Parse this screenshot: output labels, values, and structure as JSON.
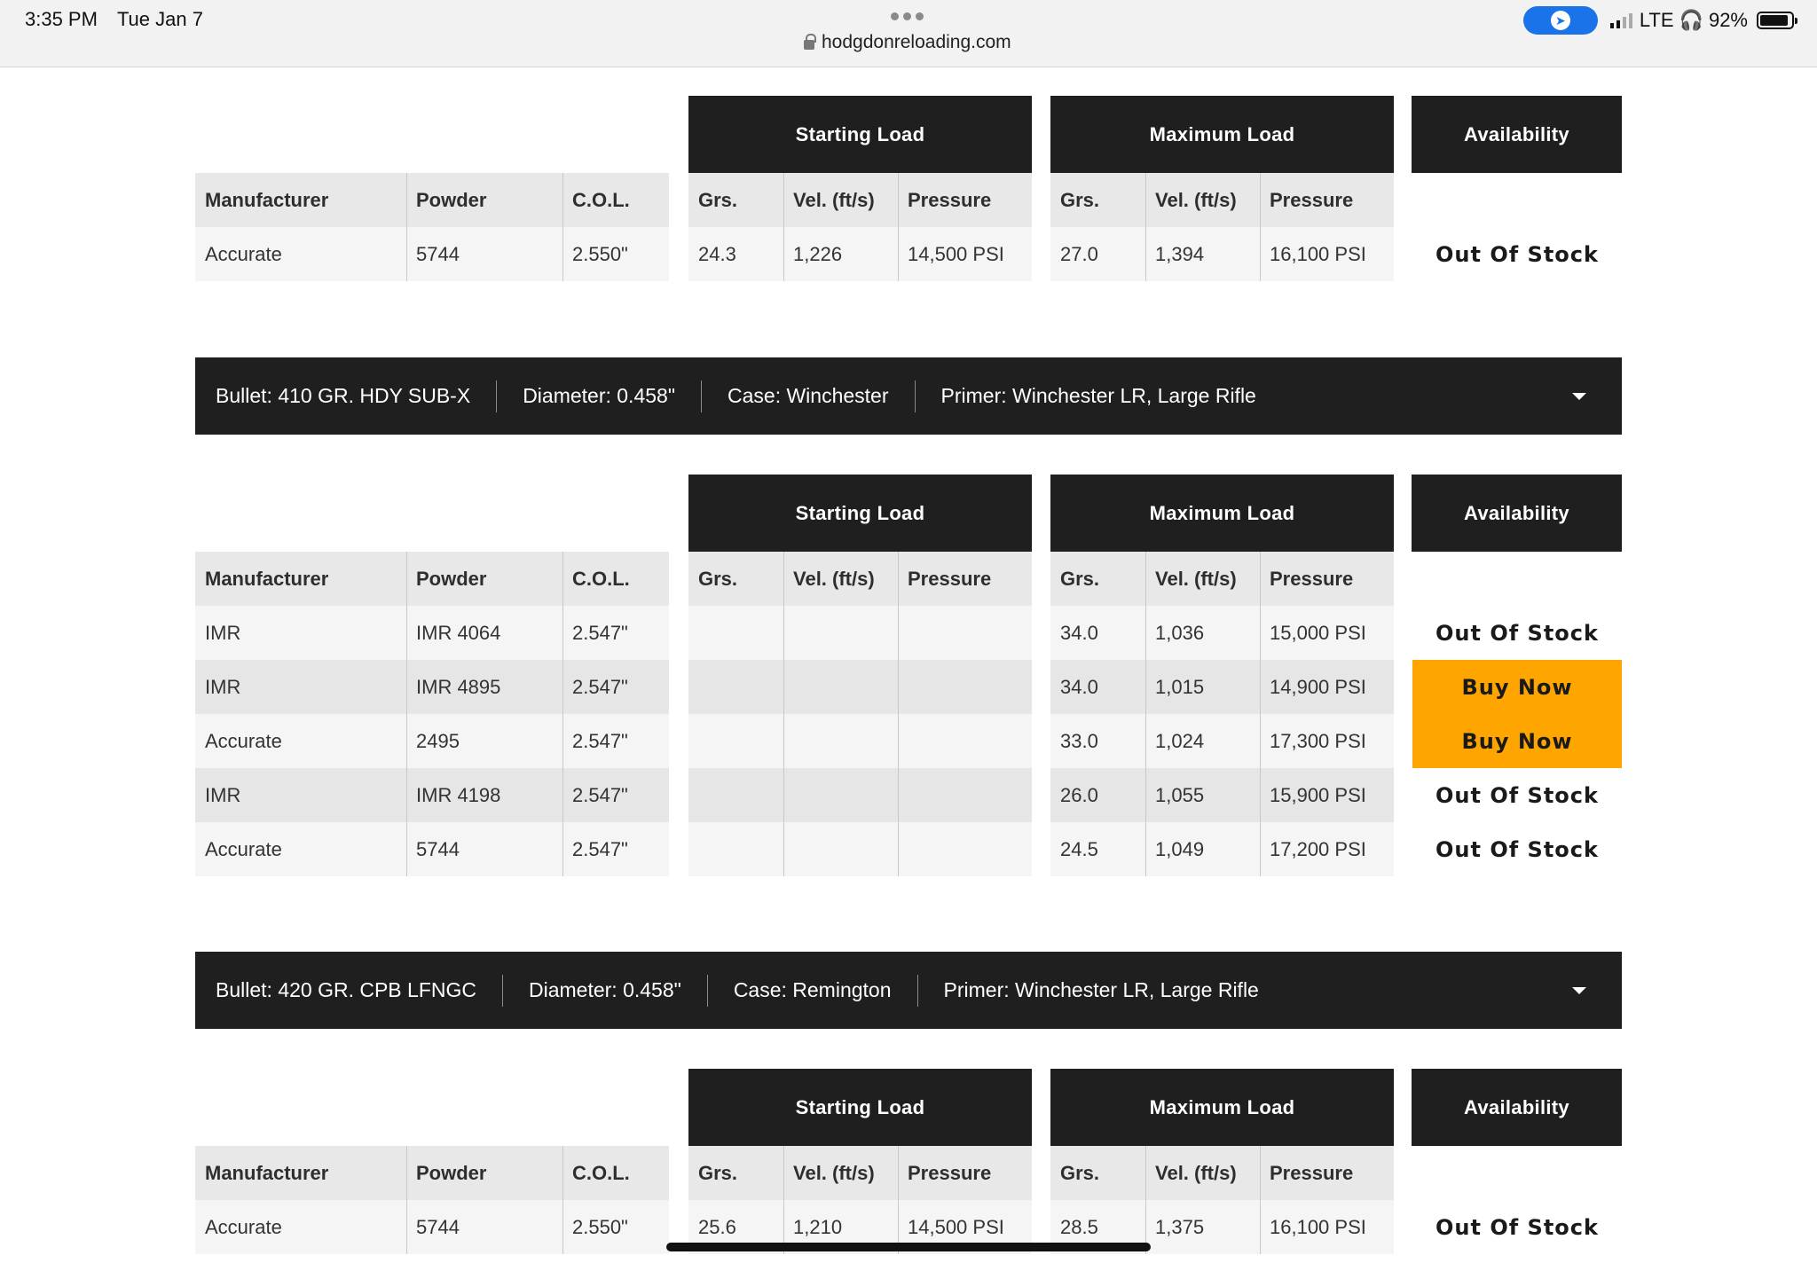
{
  "status": {
    "time": "3:35 PM",
    "date": "Tue Jan 7",
    "url": "hodgdonreloading.com",
    "network": "LTE",
    "battery": "92%"
  },
  "headers": {
    "starting": "Starting Load",
    "maximum": "Maximum Load",
    "availability": "Availability"
  },
  "columns": {
    "manufacturer": "Manufacturer",
    "powder": "Powder",
    "col": "C.O.L.",
    "grs": "Grs.",
    "vel": "Vel. (ft/s)",
    "pressure": "Pressure"
  },
  "table1": {
    "rows": [
      {
        "manufacturer": "Accurate",
        "powder": "5744",
        "col": "2.550\"",
        "s_grs": "24.3",
        "s_vel": "1,226",
        "s_pres": "14,500 PSI",
        "m_grs": "27.0",
        "m_vel": "1,394",
        "m_pres": "16,100 PSI",
        "availability": "Out Of Stock"
      }
    ]
  },
  "bullet2": {
    "bullet": "Bullet: 410 GR. HDY SUB-X",
    "diameter": "Diameter: 0.458\"",
    "case": "Case: Winchester",
    "primer": "Primer: Winchester LR, Large Rifle"
  },
  "table2": {
    "rows": [
      {
        "manufacturer": "IMR",
        "powder": "IMR 4064",
        "col": "2.547\"",
        "s_grs": "",
        "s_vel": "",
        "s_pres": "",
        "m_grs": "34.0",
        "m_vel": "1,036",
        "m_pres": "15,000 PSI",
        "availability": "Out Of Stock"
      },
      {
        "manufacturer": "IMR",
        "powder": "IMR 4895",
        "col": "2.547\"",
        "s_grs": "",
        "s_vel": "",
        "s_pres": "",
        "m_grs": "34.0",
        "m_vel": "1,015",
        "m_pres": "14,900 PSI",
        "availability": "Buy Now"
      },
      {
        "manufacturer": "Accurate",
        "powder": "2495",
        "col": "2.547\"",
        "s_grs": "",
        "s_vel": "",
        "s_pres": "",
        "m_grs": "33.0",
        "m_vel": "1,024",
        "m_pres": "17,300 PSI",
        "availability": "Buy Now"
      },
      {
        "manufacturer": "IMR",
        "powder": "IMR 4198",
        "col": "2.547\"",
        "s_grs": "",
        "s_vel": "",
        "s_pres": "",
        "m_grs": "26.0",
        "m_vel": "1,055",
        "m_pres": "15,900 PSI",
        "availability": "Out Of Stock"
      },
      {
        "manufacturer": "Accurate",
        "powder": "5744",
        "col": "2.547\"",
        "s_grs": "",
        "s_vel": "",
        "s_pres": "",
        "m_grs": "24.5",
        "m_vel": "1,049",
        "m_pres": "17,200 PSI",
        "availability": "Out Of Stock"
      }
    ]
  },
  "bullet3": {
    "bullet": "Bullet: 420 GR. CPB LFNGC",
    "diameter": "Diameter: 0.458\"",
    "case": "Case: Remington",
    "primer": "Primer: Winchester LR, Large Rifle"
  },
  "table3": {
    "rows": [
      {
        "manufacturer": "Accurate",
        "powder": "5744",
        "col": "2.550\"",
        "s_grs": "25.6",
        "s_vel": "1,210",
        "s_pres": "14,500 PSI",
        "m_grs": "28.5",
        "m_vel": "1,375",
        "m_pres": "16,100 PSI",
        "availability": "Out Of Stock"
      }
    ]
  },
  "colors": {
    "dark": "#1f1f1f",
    "buy": "#ffa500"
  }
}
